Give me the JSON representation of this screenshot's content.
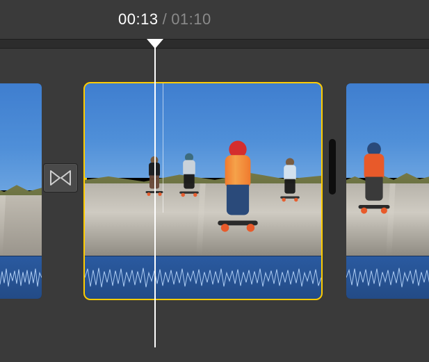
{
  "timecode": {
    "current": "00:13",
    "separator": "/",
    "total": "01:10"
  },
  "colors": {
    "selection": "#ffcc00",
    "audio_track": "#2a5aa0",
    "playhead": "#ffffff"
  },
  "timeline": {
    "clips": [
      {
        "id": "clip-prev",
        "selected": false,
        "has_audio": true
      },
      {
        "id": "clip-current",
        "selected": true,
        "has_audio": true
      },
      {
        "id": "clip-next",
        "selected": false,
        "has_audio": true
      }
    ],
    "transition": {
      "type": "cross-dissolve",
      "position": "between-prev-and-current"
    },
    "playhead_position_sec": 13
  }
}
